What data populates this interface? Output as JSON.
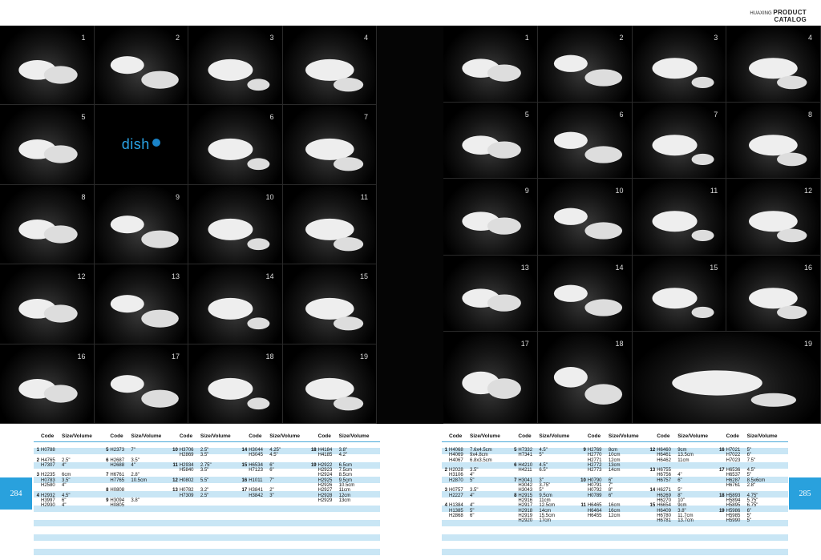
{
  "brand": {
    "company": "HUAXING",
    "title1": "PRODUCT",
    "title2": "CATALOG"
  },
  "logo": {
    "text": "dish"
  },
  "left_cells": [
    "1",
    "2",
    "3",
    "4",
    "5",
    "",
    "6",
    "7",
    "8",
    "9",
    "10",
    "11",
    "12",
    "13",
    "14",
    "15",
    "16",
    "17",
    "18",
    "19"
  ],
  "right_cells": [
    "1",
    "2",
    "3",
    "4",
    "5",
    "6",
    "7",
    "8",
    "9",
    "10",
    "11",
    "12",
    "13",
    "14",
    "15",
    "16",
    "17",
    "18",
    "19"
  ],
  "page_numbers": {
    "left": "284",
    "right": "285"
  },
  "table_headers": {
    "code": "Code",
    "size": "Size/Volume"
  },
  "left_table": [
    [
      {
        "n": "1",
        "c": "H0788",
        "s": ""
      },
      {
        "n": "",
        "c": "",
        "s": ""
      },
      {
        "n": "2",
        "c": "H4765",
        "s": "2.5\""
      },
      {
        "n": "",
        "c": "H7307",
        "s": "4\""
      },
      {
        "n": "",
        "c": "",
        "s": ""
      },
      {
        "n": "3",
        "c": "H2235",
        "s": "6cm"
      },
      {
        "n": "",
        "c": "H0783",
        "s": "3.5\""
      },
      {
        "n": "",
        "c": "H2580",
        "s": "4\""
      },
      {
        "n": "",
        "c": "",
        "s": ""
      },
      {
        "n": "4",
        "c": "H2932",
        "s": "4.5\""
      },
      {
        "n": "",
        "c": "H3997",
        "s": "6\""
      },
      {
        "n": "",
        "c": "H2930",
        "s": "4\""
      }
    ],
    [
      {
        "n": "5",
        "c": "H2373",
        "s": "7\""
      },
      {
        "n": "",
        "c": "",
        "s": ""
      },
      {
        "n": "6",
        "c": "H2687",
        "s": "3.5\""
      },
      {
        "n": "",
        "c": "H2688",
        "s": "4\""
      },
      {
        "n": "",
        "c": "",
        "s": ""
      },
      {
        "n": "7",
        "c": "H6761",
        "s": "2.8\""
      },
      {
        "n": "",
        "c": "H7765",
        "s": "10.5cm"
      },
      {
        "n": "",
        "c": "",
        "s": ""
      },
      {
        "n": "8",
        "c": "H0808",
        "s": ""
      },
      {
        "n": "",
        "c": "",
        "s": ""
      },
      {
        "n": "9",
        "c": "H3094",
        "s": "3.8\""
      },
      {
        "n": "",
        "c": "H0805",
        "s": ""
      }
    ],
    [
      {
        "n": "10",
        "c": "H3706",
        "s": "2.5\""
      },
      {
        "n": "",
        "c": "H2869",
        "s": "3.5\""
      },
      {
        "n": "",
        "c": "",
        "s": ""
      },
      {
        "n": "11",
        "c": "H2934",
        "s": "2.75\""
      },
      {
        "n": "",
        "c": "H5840",
        "s": "3.5\""
      },
      {
        "n": "",
        "c": "",
        "s": ""
      },
      {
        "n": "12",
        "c": "H0802",
        "s": "5.5\""
      },
      {
        "n": "",
        "c": "",
        "s": ""
      },
      {
        "n": "13",
        "c": "H0782",
        "s": "3.2\""
      },
      {
        "n": "",
        "c": "H7309",
        "s": "2.5\""
      }
    ],
    [
      {
        "n": "14",
        "c": "H3044",
        "s": "4.25\""
      },
      {
        "n": "",
        "c": "H3045",
        "s": "4.5\""
      },
      {
        "n": "",
        "c": "",
        "s": ""
      },
      {
        "n": "15",
        "c": "H6534",
        "s": "6\""
      },
      {
        "n": "",
        "c": "H7123",
        "s": "6\""
      },
      {
        "n": "",
        "c": "",
        "s": ""
      },
      {
        "n": "16",
        "c": "H1011",
        "s": "7\""
      },
      {
        "n": "",
        "c": "",
        "s": ""
      },
      {
        "n": "17",
        "c": "H3841",
        "s": "2\""
      },
      {
        "n": "",
        "c": "H3842",
        "s": "3\""
      }
    ],
    [
      {
        "n": "18",
        "c": "H4184",
        "s": "3.8\""
      },
      {
        "n": "",
        "c": "H4185",
        "s": "4.2\""
      },
      {
        "n": "",
        "c": "",
        "s": ""
      },
      {
        "n": "19",
        "c": "H2922",
        "s": "6.5cm"
      },
      {
        "n": "",
        "c": "H2923",
        "s": "7.5cm"
      },
      {
        "n": "",
        "c": "H2924",
        "s": "8.5cm"
      },
      {
        "n": "",
        "c": "H2925",
        "s": "9.5cm"
      },
      {
        "n": "",
        "c": "H2926",
        "s": "10.5cm"
      },
      {
        "n": "",
        "c": "H2927",
        "s": "11cm"
      },
      {
        "n": "",
        "c": "H2928",
        "s": "12cm"
      },
      {
        "n": "",
        "c": "H2929",
        "s": "13cm"
      }
    ]
  ],
  "right_table": [
    [
      {
        "n": "1",
        "c": "H4068",
        "s": "7.6x4.5cm"
      },
      {
        "n": "",
        "c": "H4069",
        "s": "9x4.8cm"
      },
      {
        "n": "",
        "c": "H4067",
        "s": "6.8x3.5cm"
      },
      {
        "n": "",
        "c": "",
        "s": ""
      },
      {
        "n": "2",
        "c": "H2028",
        "s": "3.5\""
      },
      {
        "n": "",
        "c": "H3106",
        "s": "4\""
      },
      {
        "n": "",
        "c": "H2870",
        "s": "5\""
      },
      {
        "n": "",
        "c": "",
        "s": ""
      },
      {
        "n": "3",
        "c": "H0757",
        "s": "3.5\""
      },
      {
        "n": "",
        "c": "H2227",
        "s": "4\""
      },
      {
        "n": "",
        "c": "",
        "s": ""
      },
      {
        "n": "4",
        "c": "H1384",
        "s": "4\""
      },
      {
        "n": "",
        "c": "H1385",
        "s": "5\""
      },
      {
        "n": "",
        "c": "H2868",
        "s": "6\""
      }
    ],
    [
      {
        "n": "5",
        "c": "H7332",
        "s": "4.5\""
      },
      {
        "n": "",
        "c": "H7341",
        "s": "5\""
      },
      {
        "n": "",
        "c": "",
        "s": ""
      },
      {
        "n": "6",
        "c": "H4210",
        "s": "4.5\""
      },
      {
        "n": "",
        "c": "H4211",
        "s": "6.5\""
      },
      {
        "n": "",
        "c": "",
        "s": ""
      },
      {
        "n": "7",
        "c": "H3041",
        "s": "3\""
      },
      {
        "n": "",
        "c": "H3042",
        "s": "3.75\""
      },
      {
        "n": "",
        "c": "H3043",
        "s": "5\""
      },
      {
        "n": "8",
        "c": "H2915",
        "s": "9.5cm"
      },
      {
        "n": "",
        "c": "H2916",
        "s": "11cm"
      },
      {
        "n": "",
        "c": "H2917",
        "s": "12.5cm"
      },
      {
        "n": "",
        "c": "H2918",
        "s": "14cm"
      },
      {
        "n": "",
        "c": "H2919",
        "s": "15.5cm"
      },
      {
        "n": "",
        "c": "H2920",
        "s": "17cm"
      }
    ],
    [
      {
        "n": "9",
        "c": "H2769",
        "s": "8cm"
      },
      {
        "n": "",
        "c": "H2770",
        "s": "10cm"
      },
      {
        "n": "",
        "c": "H2771",
        "s": "12cm"
      },
      {
        "n": "",
        "c": "H2772",
        "s": "13cm"
      },
      {
        "n": "",
        "c": "H2773",
        "s": "14cm"
      },
      {
        "n": "",
        "c": "",
        "s": ""
      },
      {
        "n": "10",
        "c": "H0790",
        "s": "6\""
      },
      {
        "n": "",
        "c": "H0791",
        "s": "7\""
      },
      {
        "n": "",
        "c": "H0792",
        "s": "8\""
      },
      {
        "n": "",
        "c": "H0789",
        "s": "6\""
      },
      {
        "n": "",
        "c": "",
        "s": ""
      },
      {
        "n": "11",
        "c": "H6465",
        "s": "16cm"
      },
      {
        "n": "",
        "c": "H6464",
        "s": "16cm"
      },
      {
        "n": "",
        "c": "H6455",
        "s": "12cm"
      }
    ],
    [
      {
        "n": "12",
        "c": "H6460",
        "s": "9cm"
      },
      {
        "n": "",
        "c": "H6461",
        "s": "13.5cm"
      },
      {
        "n": "",
        "c": "H6462",
        "s": "11cm"
      },
      {
        "n": "",
        "c": "",
        "s": ""
      },
      {
        "n": "13",
        "c": "H6755",
        "s": ""
      },
      {
        "n": "",
        "c": "H6756",
        "s": "4\""
      },
      {
        "n": "",
        "c": "H6757",
        "s": "6\""
      },
      {
        "n": "",
        "c": "",
        "s": ""
      },
      {
        "n": "14",
        "c": "H6271",
        "s": "5\""
      },
      {
        "n": "",
        "c": "H6269",
        "s": "8\""
      },
      {
        "n": "",
        "c": "H6270",
        "s": "10\""
      },
      {
        "n": "15",
        "c": "H6654",
        "s": "9cm"
      },
      {
        "n": "",
        "c": "H6409",
        "s": "3.8\""
      },
      {
        "n": "",
        "c": "H6780",
        "s": "11.7cm"
      },
      {
        "n": "",
        "c": "H6781",
        "s": "13.7cm"
      }
    ],
    [
      {
        "n": "16",
        "c": "H7021",
        "s": "5\""
      },
      {
        "n": "",
        "c": "H7022",
        "s": "6\""
      },
      {
        "n": "",
        "c": "H7023",
        "s": "7.5\""
      },
      {
        "n": "",
        "c": "",
        "s": ""
      },
      {
        "n": "17",
        "c": "H6536",
        "s": "4.5\""
      },
      {
        "n": "",
        "c": "H6537",
        "s": "5\""
      },
      {
        "n": "",
        "c": "H6287",
        "s": "8.5x6cm"
      },
      {
        "n": "",
        "c": "H6761",
        "s": "2.8\""
      },
      {
        "n": "",
        "c": "",
        "s": ""
      },
      {
        "n": "18",
        "c": "H5893",
        "s": "4.75\""
      },
      {
        "n": "",
        "c": "H5894",
        "s": "5.75\""
      },
      {
        "n": "",
        "c": "H5895",
        "s": "6.75\""
      },
      {
        "n": "19",
        "c": "H5986",
        "s": "6\""
      },
      {
        "n": "",
        "c": "H5985",
        "s": "5\""
      },
      {
        "n": "",
        "c": "H5990",
        "s": "5\""
      }
    ]
  ]
}
